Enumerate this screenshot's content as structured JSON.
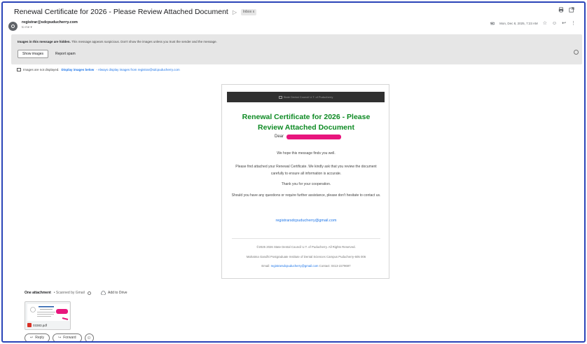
{
  "email": {
    "subject": "Renewal Certificate for 2026 - Please Review Attached Document",
    "label_chip": "Inbox x",
    "sender": "registrar@sdcpuducherry.com",
    "to_me": "to me",
    "date": "Mon, Dec 8, 2025, 7:23 AM"
  },
  "warning": {
    "message_bold": "Images in this message are hidden.",
    "message": " This message appears suspicious. Don't show the images unless you trust the sender and the message.",
    "show_images": "Show images",
    "report_spam": "Report spam"
  },
  "images_notice": {
    "text": "Images are not displayed.",
    "display_link": "Display images below",
    "always_link": "- Always display images from registrar@sdcpuducherry.com"
  },
  "body": {
    "banner_alt": "State Dental Council U.T. of Puducherry",
    "title": "Renewal Certificate for 2026 - Please Review Attached Document",
    "dear": "Dear",
    "p1": "We hope this message finds you well.",
    "p2": "Please find attached your Renewal Certificate. We kindly ask that you review the document carefully to ensure all information is accurate.",
    "p3": "Thank you for your cooperation.",
    "p4": "Should you have any questions or require further assistance, please don't hesitate to contact us.",
    "contact_email": "registrarsdcpuducherry@gmail.com",
    "footer1": "©2025 2026 State Dental Council U.T. of Puducherry. All Rights Reserved.",
    "footer2": "Mahatma Gandhi Postgraduate Institute of Dental Sciences Campus Puducherry-605 006",
    "footer3_label": "Email:",
    "footer3_email": "registrarsdcpuducherry@gmail.com",
    "footer3_contact": "Contact: 0413-2279697"
  },
  "attachments": {
    "header_bold": "One attachment",
    "scanned": "• Scanned by Gmail",
    "add_to_drive": "Add to Drive",
    "file_name": "03383.pdf"
  },
  "actions": {
    "reply": "Reply",
    "forward": "Forward"
  },
  "colors": {
    "title_green": "#0d8a23",
    "link_blue": "#1a73e8",
    "redaction": "#e8157d",
    "frame_border": "#2a44b8"
  }
}
